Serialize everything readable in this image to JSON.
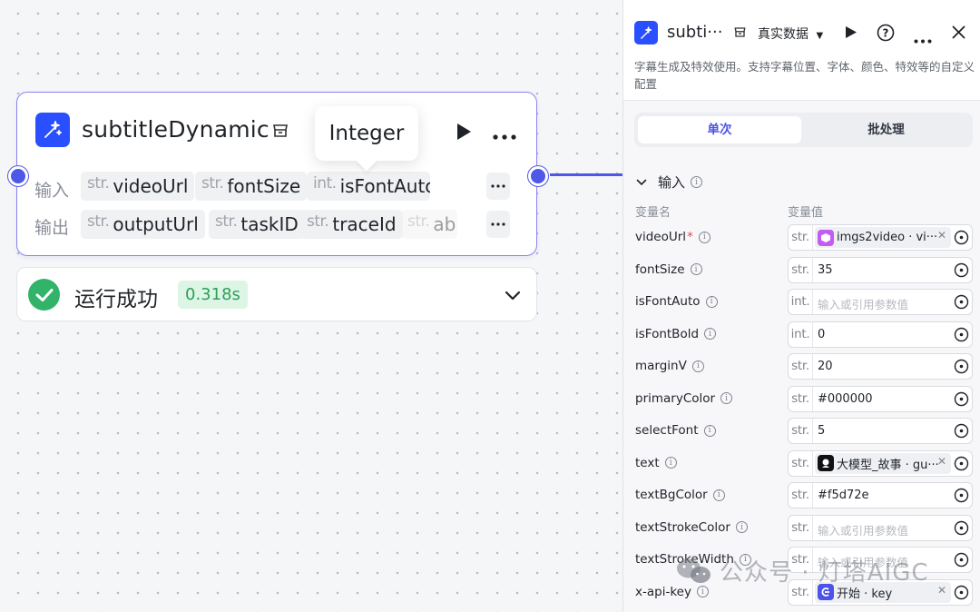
{
  "node": {
    "title": "subtitleDynamic",
    "input_label": "输入",
    "output_label": "输出",
    "inputs": [
      {
        "type": "str.",
        "name": "videoUrl"
      },
      {
        "type": "str.",
        "name": "fontSize"
      },
      {
        "type": "int.",
        "name": "isFontAuto"
      }
    ],
    "outputs": [
      {
        "type": "str.",
        "name": "outputUrl"
      },
      {
        "type": "str.",
        "name": "taskID"
      },
      {
        "type": "str.",
        "name": "traceId"
      },
      {
        "type": "str.",
        "name": "ab"
      }
    ],
    "tooltip": "Integer",
    "status_text": "运行成功",
    "status_time": "0.318s"
  },
  "panel": {
    "title": "subti···",
    "mode": "真实数据",
    "description": "字幕生成及特效使用。支持字幕位置、字体、颜色、特效等的自定义配置",
    "tabs": [
      "单次",
      "批处理"
    ],
    "section": "输入",
    "col_name": "变量名",
    "col_value": "变量值",
    "params": [
      {
        "name": "videoUrl",
        "required": "*",
        "type": "str.",
        "kind": "tag",
        "value": "imgs2video · vi···",
        "icon": "cube-icon",
        "icon_color": "#c35cf0"
      },
      {
        "name": "fontSize",
        "type": "str.",
        "kind": "value",
        "value": "35"
      },
      {
        "name": "isFontAuto",
        "type": "int.",
        "kind": "placeholder",
        "value": "输入或引用参数值"
      },
      {
        "name": "isFontBold",
        "type": "int.",
        "kind": "value",
        "value": "0"
      },
      {
        "name": "marginV",
        "type": "str.",
        "kind": "value",
        "value": "20"
      },
      {
        "name": "primaryColor",
        "type": "str.",
        "kind": "value",
        "value": "#000000"
      },
      {
        "name": "selectFont",
        "type": "str.",
        "kind": "value",
        "value": "5"
      },
      {
        "name": "text",
        "type": "str.",
        "kind": "tag",
        "value": "大模型_故事 · gu···",
        "icon": "llm-icon",
        "icon_color": "#111111"
      },
      {
        "name": "textBgColor",
        "type": "str.",
        "kind": "value",
        "value": "#f5d72e"
      },
      {
        "name": "textStrokeColor",
        "type": "str.",
        "kind": "placeholder",
        "value": "输入或引用参数值"
      },
      {
        "name": "textStrokeWidth",
        "type": "str.",
        "kind": "placeholder",
        "value": "输入或引用参数值"
      },
      {
        "name": "x-api-key",
        "type": "str.",
        "kind": "tag",
        "value": "开始 · key",
        "icon": "start-icon",
        "icon_color": "#4d53e8"
      }
    ]
  },
  "watermark": "公众号 · 灯塔AIGC",
  "colors": {
    "accent": "#4d53e8",
    "brand": "#2a4fff",
    "success": "#32b36a"
  }
}
